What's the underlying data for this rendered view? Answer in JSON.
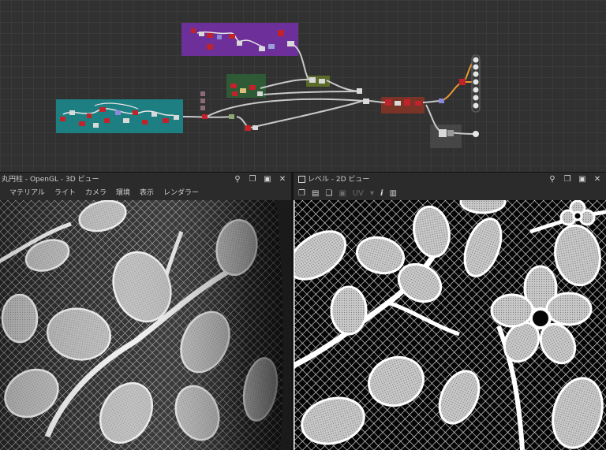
{
  "graph": {
    "frames": [
      {
        "name": "frame-purple",
        "color": "#6d2f9a"
      },
      {
        "name": "frame-teal",
        "color": "#1e7f82"
      },
      {
        "name": "frame-green",
        "color": "#2e5a36"
      },
      {
        "name": "frame-red",
        "color": "#7a3327"
      },
      {
        "name": "frame-dark",
        "color": "#464646"
      }
    ],
    "node_color_red": "#c2222a",
    "node_color_gray": "#d9d9d9",
    "wire_color": "#c9c9c9",
    "wire_color_orange": "#e79a32"
  },
  "view3d": {
    "title": "丸円柱 - OpenGL - 3D ビュー",
    "menu": [
      "マテリアル",
      "ライト",
      "カメラ",
      "環境",
      "表示",
      "レンダラー"
    ]
  },
  "view2d": {
    "title": "レベル - 2D ビュー",
    "toolbar_uv": "UV",
    "info_icon": "i"
  },
  "window_icons": {
    "pin": "⚲",
    "restore": "❐",
    "maximize": "▣",
    "close": "✕"
  }
}
